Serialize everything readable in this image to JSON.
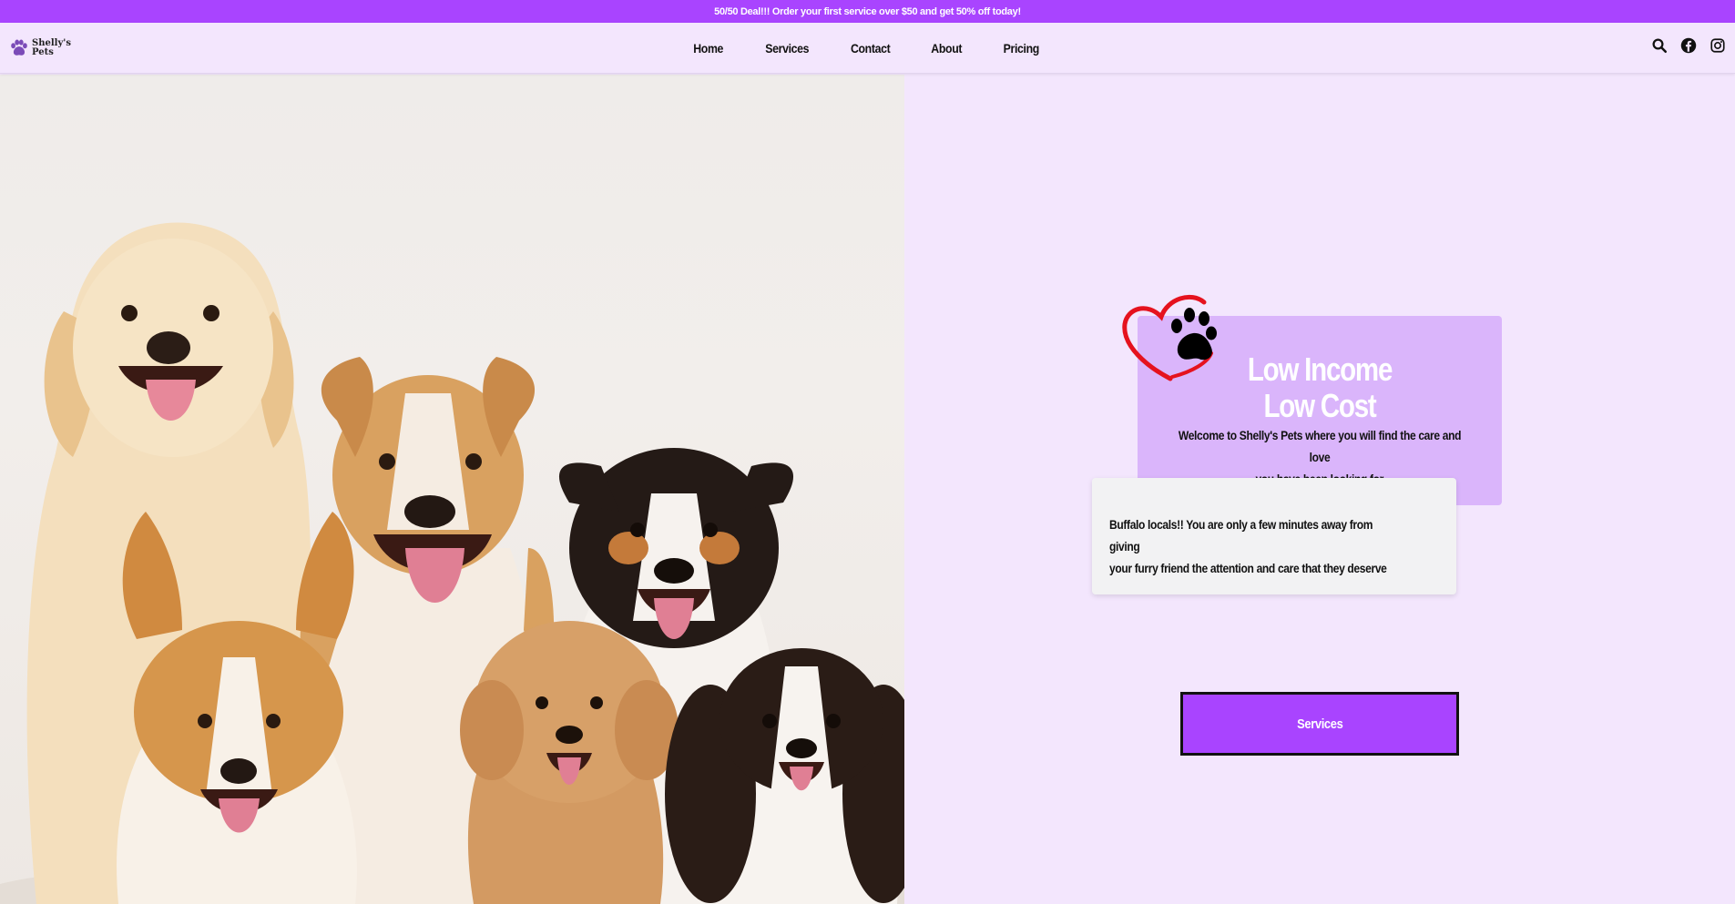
{
  "announcement": "50/50 Deal!!! Order your first service over $50 and get 50% off today!",
  "brand": {
    "line1": "Shelly's",
    "line2": "Pets",
    "accent": "#a944ff"
  },
  "nav": [
    {
      "label": "Home"
    },
    {
      "label": "Services"
    },
    {
      "label": "Contact"
    },
    {
      "label": "About"
    },
    {
      "label": "Pricing"
    }
  ],
  "header_icons": [
    "search-icon",
    "facebook-icon",
    "instagram-icon"
  ],
  "hero": {
    "image_alt": "group of smiling dogs",
    "title_line1": "Low Income",
    "title_line2": "Low Cost",
    "subtitle_line1": "Welcome to Shelly's Pets where you will find the care and love",
    "subtitle_line2": "you have been looking for",
    "locals_line1": "Buffalo locals!! You are only a few minutes away from giving",
    "locals_line2": "your furry friend the attention and care that they deserve",
    "cta_label": "Services"
  },
  "colors": {
    "announce_bg": "#a944ff",
    "page_bg": "#f3e6fd",
    "card_purple": "#dab5fb",
    "card_grey": "#f2f2f3",
    "cta_bg": "#a944ff"
  }
}
